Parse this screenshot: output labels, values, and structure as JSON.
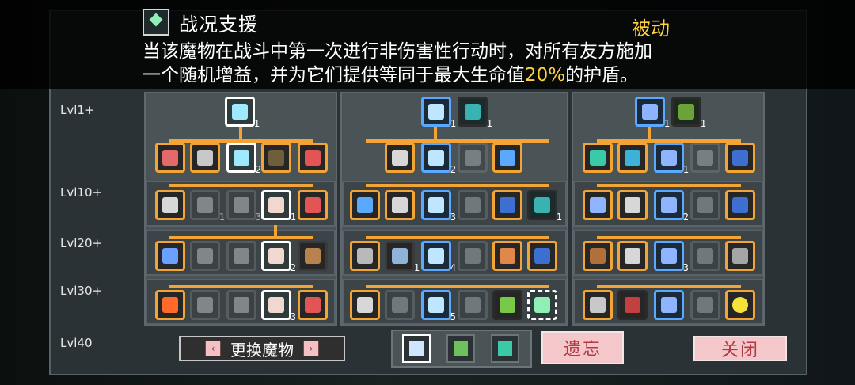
{
  "tooltip": {
    "title": "战况支援",
    "type": "被动",
    "desc_line1": "当该魔物在战斗中第一次进行非伤害性行动时，对所有友方施加",
    "desc_line2_prefix": "一个随机增益，并为它们提供等同于最大生命值",
    "desc_line2_highlight": "20%",
    "desc_line2_suffix": "的护盾。"
  },
  "levels": [
    "Lvl1+",
    "Lvl10+",
    "Lvl20+",
    "Lvl30+",
    "Lvl40"
  ],
  "columns": {
    "left": {
      "top": [
        {
          "icon": "crossed-swords-icon",
          "count": "1"
        }
      ],
      "row1": [
        {
          "icon": "hearts-icon"
        },
        {
          "icon": "trophy-icon"
        },
        {
          "icon": "crossed-swords-icon",
          "count": "2"
        },
        {
          "icon": "crosshair-icon"
        },
        {
          "icon": "heart-plus-icon"
        }
      ],
      "row2": [
        {
          "icon": "heart-bars-icon"
        },
        {
          "icon": "claw-icon",
          "count": "1"
        },
        {
          "icon": "crossed-swords-icon",
          "count": "3"
        },
        {
          "icon": "slash-icon",
          "count": "1"
        },
        {
          "icon": "heart-burst-icon"
        }
      ],
      "row3": [
        {
          "icon": "orb-icon"
        },
        {
          "icon": "claw-icon"
        },
        {
          "icon": "crossed-swords-icon"
        },
        {
          "icon": "slash-icon",
          "count": "2"
        },
        {
          "icon": "blade-icon"
        }
      ],
      "row4": [
        {
          "icon": "fire-icon"
        },
        {
          "icon": "claw-icon"
        },
        {
          "icon": "crossed-swords-icon"
        },
        {
          "icon": "slash-icon",
          "count": "3"
        },
        {
          "icon": "crossed-blades-icon"
        }
      ]
    },
    "middle": {
      "top": [
        {
          "icon": "feather-icon",
          "count": "1"
        },
        {
          "icon": "target-icon",
          "count": "1"
        }
      ],
      "row1": [
        {
          "icon": "pen-bars-icon"
        },
        {
          "icon": "feather-icon",
          "count": "2"
        },
        {
          "icon": "square-icon"
        },
        {
          "icon": "drop-icon"
        }
      ],
      "row2": [
        {
          "icon": "drop-swirl-icon"
        },
        {
          "icon": "cd-icon"
        },
        {
          "icon": "feather-icon",
          "count": "3"
        },
        {
          "icon": "square-icon"
        },
        {
          "icon": "shield-drop-icon"
        },
        {
          "icon": "target-plus-icon",
          "count": "1"
        }
      ],
      "row3": [
        {
          "icon": "note-icon"
        },
        {
          "icon": "wrench-icon",
          "count": "1"
        },
        {
          "icon": "feather-icon",
          "count": "4"
        },
        {
          "icon": "square-icon"
        },
        {
          "icon": "cog-drop-icon"
        },
        {
          "icon": "leaf-icon"
        }
      ],
      "row4": [
        {
          "icon": "crt-icon"
        },
        {
          "icon": "claw-icon"
        },
        {
          "icon": "feather-icon",
          "count": "5"
        },
        {
          "icon": "square-icon"
        },
        {
          "icon": "chain-icon"
        },
        {
          "icon": "heart-sparkle-icon"
        }
      ]
    },
    "right": {
      "top": [
        {
          "icon": "wand-icon",
          "count": "1"
        },
        {
          "icon": "shield-icon",
          "count": "1"
        }
      ],
      "row1": [
        {
          "icon": "arrow-up-icon"
        },
        {
          "icon": "ring-icon"
        },
        {
          "icon": "gem-icon",
          "count": "1"
        },
        {
          "icon": "square-icon"
        },
        {
          "icon": "shield-drop-icon"
        }
      ],
      "row2": [
        {
          "icon": "book-icon"
        },
        {
          "icon": "cloud-bars-icon"
        },
        {
          "icon": "gem-icon",
          "count": "2"
        },
        {
          "icon": "square-icon"
        },
        {
          "icon": "shield-drop-icon"
        }
      ],
      "row3": [
        {
          "icon": "fist-icon"
        },
        {
          "icon": "heart-bars-icon"
        },
        {
          "icon": "gem-icon",
          "count": "3"
        },
        {
          "icon": "square-icon"
        },
        {
          "icon": "image-icon"
        }
      ],
      "row4": [
        {
          "icon": "trophy-icon"
        },
        {
          "icon": "diamond-icon"
        },
        {
          "icon": "gem-icon"
        },
        {
          "icon": "square-icon"
        },
        {
          "icon": "ring-glow-icon"
        }
      ]
    }
  },
  "buttons": {
    "swap_label": "更换魔物",
    "forget_label": "遗忘",
    "close_label": "关闭"
  },
  "tabs": [
    {
      "icon": "claw-tab-icon"
    },
    {
      "icon": "swap-tab-icon"
    },
    {
      "icon": "arch-tab-icon"
    }
  ],
  "colors": {
    "accent": "#f2a534",
    "highlight": "#ffd13a",
    "blue": "#5aa9ff"
  }
}
